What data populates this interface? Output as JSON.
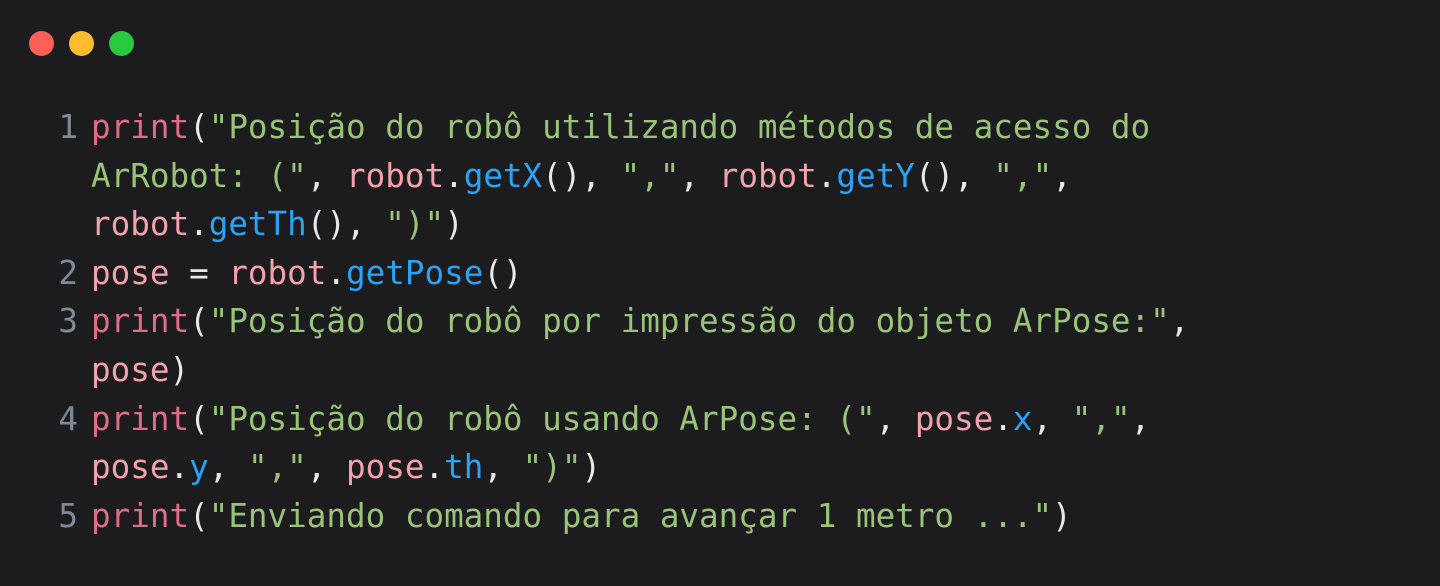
{
  "window": {
    "traffic_lights": [
      {
        "name": "close",
        "color": "#ff5f57"
      },
      {
        "name": "minimize",
        "color": "#febc2e"
      },
      {
        "name": "zoom",
        "color": "#28c840"
      }
    ]
  },
  "colors": {
    "background": "#1c1c1e",
    "function": "#e06c86",
    "string": "#98c379",
    "object": "#f3a1ab",
    "method": "#2aa3f5",
    "punctuation": "#e8e8e8",
    "line_number": "#7f8a99"
  },
  "code": {
    "lines": [
      {
        "number": "1",
        "rows": [
          [
            {
              "t": "fn",
              "v": "print"
            },
            {
              "t": "punc",
              "v": "("
            },
            {
              "t": "str",
              "v": "\"Posição do robô utilizando métodos de acesso do"
            }
          ],
          [
            {
              "t": "str",
              "v": "ArRobot: (\""
            },
            {
              "t": "punc",
              "v": ", "
            },
            {
              "t": "obj",
              "v": "robot"
            },
            {
              "t": "punc",
              "v": "."
            },
            {
              "t": "meth",
              "v": "getX"
            },
            {
              "t": "punc",
              "v": "(), "
            },
            {
              "t": "str",
              "v": "\",\""
            },
            {
              "t": "punc",
              "v": ", "
            },
            {
              "t": "obj",
              "v": "robot"
            },
            {
              "t": "punc",
              "v": "."
            },
            {
              "t": "meth",
              "v": "getY"
            },
            {
              "t": "punc",
              "v": "(), "
            },
            {
              "t": "str",
              "v": "\",\""
            },
            {
              "t": "punc",
              "v": ","
            }
          ],
          [
            {
              "t": "obj",
              "v": "robot"
            },
            {
              "t": "punc",
              "v": "."
            },
            {
              "t": "meth",
              "v": "getTh"
            },
            {
              "t": "punc",
              "v": "(), "
            },
            {
              "t": "str",
              "v": "\")\""
            },
            {
              "t": "punc",
              "v": ")"
            }
          ]
        ]
      },
      {
        "number": "2",
        "rows": [
          [
            {
              "t": "obj",
              "v": "pose"
            },
            {
              "t": "punc",
              "v": " = "
            },
            {
              "t": "obj",
              "v": "robot"
            },
            {
              "t": "punc",
              "v": "."
            },
            {
              "t": "meth",
              "v": "getPose"
            },
            {
              "t": "punc",
              "v": "()"
            }
          ]
        ]
      },
      {
        "number": "3",
        "rows": [
          [
            {
              "t": "fn",
              "v": "print"
            },
            {
              "t": "punc",
              "v": "("
            },
            {
              "t": "str",
              "v": "\"Posição do robô por impressão do objeto ArPose:\""
            },
            {
              "t": "punc",
              "v": ","
            }
          ],
          [
            {
              "t": "obj",
              "v": "pose"
            },
            {
              "t": "punc",
              "v": ")"
            }
          ]
        ]
      },
      {
        "number": "4",
        "rows": [
          [
            {
              "t": "fn",
              "v": "print"
            },
            {
              "t": "punc",
              "v": "("
            },
            {
              "t": "str",
              "v": "\"Posição do robô usando ArPose: (\""
            },
            {
              "t": "punc",
              "v": ", "
            },
            {
              "t": "obj",
              "v": "pose"
            },
            {
              "t": "punc",
              "v": "."
            },
            {
              "t": "meth",
              "v": "x"
            },
            {
              "t": "punc",
              "v": ", "
            },
            {
              "t": "str",
              "v": "\",\""
            },
            {
              "t": "punc",
              "v": ","
            }
          ],
          [
            {
              "t": "obj",
              "v": "pose"
            },
            {
              "t": "punc",
              "v": "."
            },
            {
              "t": "meth",
              "v": "y"
            },
            {
              "t": "punc",
              "v": ", "
            },
            {
              "t": "str",
              "v": "\",\""
            },
            {
              "t": "punc",
              "v": ", "
            },
            {
              "t": "obj",
              "v": "pose"
            },
            {
              "t": "punc",
              "v": "."
            },
            {
              "t": "meth",
              "v": "th"
            },
            {
              "t": "punc",
              "v": ", "
            },
            {
              "t": "str",
              "v": "\")\""
            },
            {
              "t": "punc",
              "v": ")"
            }
          ]
        ]
      },
      {
        "number": "5",
        "rows": [
          [
            {
              "t": "fn",
              "v": "print"
            },
            {
              "t": "punc",
              "v": "("
            },
            {
              "t": "str",
              "v": "\"Enviando comando para avançar 1 metro ...\""
            },
            {
              "t": "punc",
              "v": ")"
            }
          ]
        ]
      }
    ]
  }
}
